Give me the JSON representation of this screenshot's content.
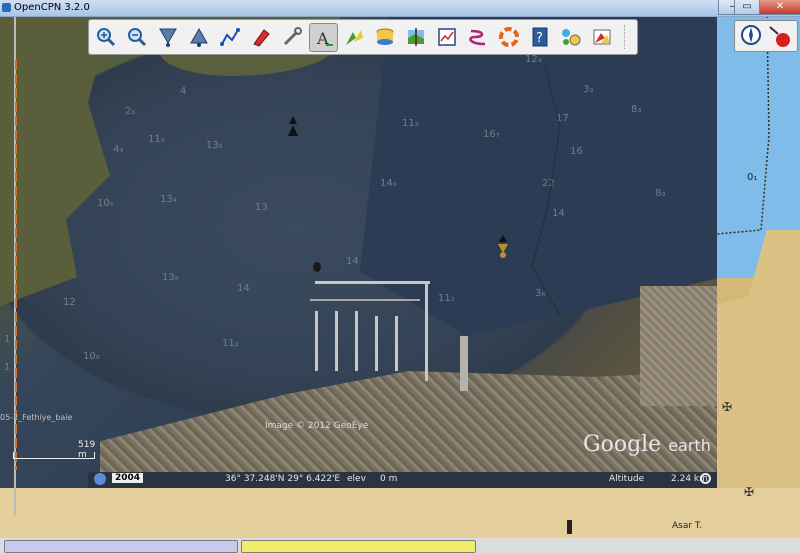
{
  "window": {
    "title": "OpenCPN 3.2.0",
    "minimize": "–",
    "maximize": "▭",
    "close": "✕"
  },
  "toolbar": {
    "buttons": [
      {
        "name": "zoom-in-icon"
      },
      {
        "name": "zoom-out-icon"
      },
      {
        "name": "scale-in-icon"
      },
      {
        "name": "scale-out-icon"
      },
      {
        "name": "route-icon"
      },
      {
        "name": "auto-follow-icon"
      },
      {
        "name": "settings-icon"
      },
      {
        "name": "text-icon",
        "active": true
      },
      {
        "name": "current-icon"
      },
      {
        "name": "tide-icon"
      },
      {
        "name": "chart-quilt-icon"
      },
      {
        "name": "print-icon"
      },
      {
        "name": "route-manager-icon"
      },
      {
        "name": "man-overboard-icon"
      },
      {
        "name": "help-icon"
      },
      {
        "name": "plugin-icon"
      },
      {
        "name": "ais-icon"
      }
    ]
  },
  "map": {
    "depths": [
      {
        "v": "12₄"
      },
      {
        "v": "3₃"
      },
      {
        "v": "4"
      },
      {
        "v": "2₆"
      },
      {
        "v": "11₃"
      },
      {
        "v": "16₇"
      },
      {
        "v": "8₃"
      },
      {
        "v": "4₄"
      },
      {
        "v": "11₅"
      },
      {
        "v": "13₅"
      },
      {
        "v": "17"
      },
      {
        "v": "16"
      },
      {
        "v": "14₉"
      },
      {
        "v": "10₅"
      },
      {
        "v": "13₄"
      },
      {
        "v": "13₈"
      },
      {
        "v": "13"
      },
      {
        "v": "22"
      },
      {
        "v": "8₉"
      },
      {
        "v": "14"
      },
      {
        "v": "14"
      },
      {
        "v": "14"
      },
      {
        "v": "11₂"
      },
      {
        "v": "3₆"
      },
      {
        "v": "12"
      },
      {
        "v": "10₈"
      },
      {
        "v": "11₂"
      },
      {
        "v": "1"
      },
      {
        "v": "1"
      }
    ],
    "credit": "Image © 2012 GeoEye",
    "logo_main": "Google",
    "logo_sub": "earth",
    "scale_label": "519 m",
    "chart_name": "05-2_Fethiye_baie",
    "right_depth": "0₁",
    "place": "Asar T."
  },
  "status": {
    "year": "2004",
    "coords": "36° 37.248'N   29° 6.422'E",
    "elev": "elev",
    "elev_val": "0 m",
    "altitude_label": "Altitude",
    "altitude_val": "2.24 km"
  },
  "colors": {
    "sea_chart": "#7fbcea",
    "land_chart": "#dcc185",
    "progress_blue": "#c9c8ee",
    "progress_yellow": "#f3ec6a"
  }
}
